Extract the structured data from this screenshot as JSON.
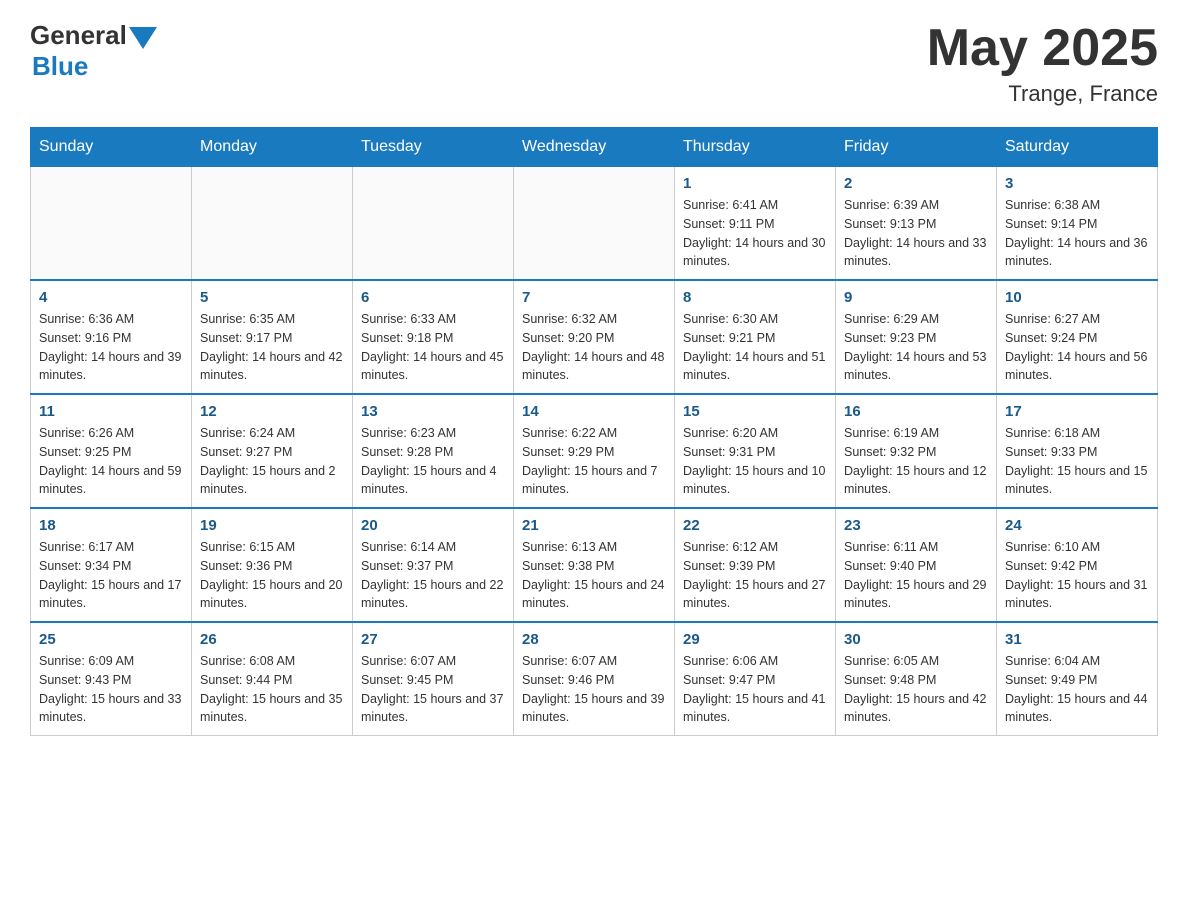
{
  "header": {
    "logo_general": "General",
    "logo_blue": "Blue",
    "month_year": "May 2025",
    "location": "Trange, France"
  },
  "days_of_week": [
    "Sunday",
    "Monday",
    "Tuesday",
    "Wednesday",
    "Thursday",
    "Friday",
    "Saturday"
  ],
  "weeks": [
    [
      {
        "day": "",
        "info": ""
      },
      {
        "day": "",
        "info": ""
      },
      {
        "day": "",
        "info": ""
      },
      {
        "day": "",
        "info": ""
      },
      {
        "day": "1",
        "info": "Sunrise: 6:41 AM\nSunset: 9:11 PM\nDaylight: 14 hours and 30 minutes."
      },
      {
        "day": "2",
        "info": "Sunrise: 6:39 AM\nSunset: 9:13 PM\nDaylight: 14 hours and 33 minutes."
      },
      {
        "day": "3",
        "info": "Sunrise: 6:38 AM\nSunset: 9:14 PM\nDaylight: 14 hours and 36 minutes."
      }
    ],
    [
      {
        "day": "4",
        "info": "Sunrise: 6:36 AM\nSunset: 9:16 PM\nDaylight: 14 hours and 39 minutes."
      },
      {
        "day": "5",
        "info": "Sunrise: 6:35 AM\nSunset: 9:17 PM\nDaylight: 14 hours and 42 minutes."
      },
      {
        "day": "6",
        "info": "Sunrise: 6:33 AM\nSunset: 9:18 PM\nDaylight: 14 hours and 45 minutes."
      },
      {
        "day": "7",
        "info": "Sunrise: 6:32 AM\nSunset: 9:20 PM\nDaylight: 14 hours and 48 minutes."
      },
      {
        "day": "8",
        "info": "Sunrise: 6:30 AM\nSunset: 9:21 PM\nDaylight: 14 hours and 51 minutes."
      },
      {
        "day": "9",
        "info": "Sunrise: 6:29 AM\nSunset: 9:23 PM\nDaylight: 14 hours and 53 minutes."
      },
      {
        "day": "10",
        "info": "Sunrise: 6:27 AM\nSunset: 9:24 PM\nDaylight: 14 hours and 56 minutes."
      }
    ],
    [
      {
        "day": "11",
        "info": "Sunrise: 6:26 AM\nSunset: 9:25 PM\nDaylight: 14 hours and 59 minutes."
      },
      {
        "day": "12",
        "info": "Sunrise: 6:24 AM\nSunset: 9:27 PM\nDaylight: 15 hours and 2 minutes."
      },
      {
        "day": "13",
        "info": "Sunrise: 6:23 AM\nSunset: 9:28 PM\nDaylight: 15 hours and 4 minutes."
      },
      {
        "day": "14",
        "info": "Sunrise: 6:22 AM\nSunset: 9:29 PM\nDaylight: 15 hours and 7 minutes."
      },
      {
        "day": "15",
        "info": "Sunrise: 6:20 AM\nSunset: 9:31 PM\nDaylight: 15 hours and 10 minutes."
      },
      {
        "day": "16",
        "info": "Sunrise: 6:19 AM\nSunset: 9:32 PM\nDaylight: 15 hours and 12 minutes."
      },
      {
        "day": "17",
        "info": "Sunrise: 6:18 AM\nSunset: 9:33 PM\nDaylight: 15 hours and 15 minutes."
      }
    ],
    [
      {
        "day": "18",
        "info": "Sunrise: 6:17 AM\nSunset: 9:34 PM\nDaylight: 15 hours and 17 minutes."
      },
      {
        "day": "19",
        "info": "Sunrise: 6:15 AM\nSunset: 9:36 PM\nDaylight: 15 hours and 20 minutes."
      },
      {
        "day": "20",
        "info": "Sunrise: 6:14 AM\nSunset: 9:37 PM\nDaylight: 15 hours and 22 minutes."
      },
      {
        "day": "21",
        "info": "Sunrise: 6:13 AM\nSunset: 9:38 PM\nDaylight: 15 hours and 24 minutes."
      },
      {
        "day": "22",
        "info": "Sunrise: 6:12 AM\nSunset: 9:39 PM\nDaylight: 15 hours and 27 minutes."
      },
      {
        "day": "23",
        "info": "Sunrise: 6:11 AM\nSunset: 9:40 PM\nDaylight: 15 hours and 29 minutes."
      },
      {
        "day": "24",
        "info": "Sunrise: 6:10 AM\nSunset: 9:42 PM\nDaylight: 15 hours and 31 minutes."
      }
    ],
    [
      {
        "day": "25",
        "info": "Sunrise: 6:09 AM\nSunset: 9:43 PM\nDaylight: 15 hours and 33 minutes."
      },
      {
        "day": "26",
        "info": "Sunrise: 6:08 AM\nSunset: 9:44 PM\nDaylight: 15 hours and 35 minutes."
      },
      {
        "day": "27",
        "info": "Sunrise: 6:07 AM\nSunset: 9:45 PM\nDaylight: 15 hours and 37 minutes."
      },
      {
        "day": "28",
        "info": "Sunrise: 6:07 AM\nSunset: 9:46 PM\nDaylight: 15 hours and 39 minutes."
      },
      {
        "day": "29",
        "info": "Sunrise: 6:06 AM\nSunset: 9:47 PM\nDaylight: 15 hours and 41 minutes."
      },
      {
        "day": "30",
        "info": "Sunrise: 6:05 AM\nSunset: 9:48 PM\nDaylight: 15 hours and 42 minutes."
      },
      {
        "day": "31",
        "info": "Sunrise: 6:04 AM\nSunset: 9:49 PM\nDaylight: 15 hours and 44 minutes."
      }
    ]
  ],
  "colors": {
    "header_bg": "#1a7abf",
    "accent_blue": "#1a5a8a"
  }
}
